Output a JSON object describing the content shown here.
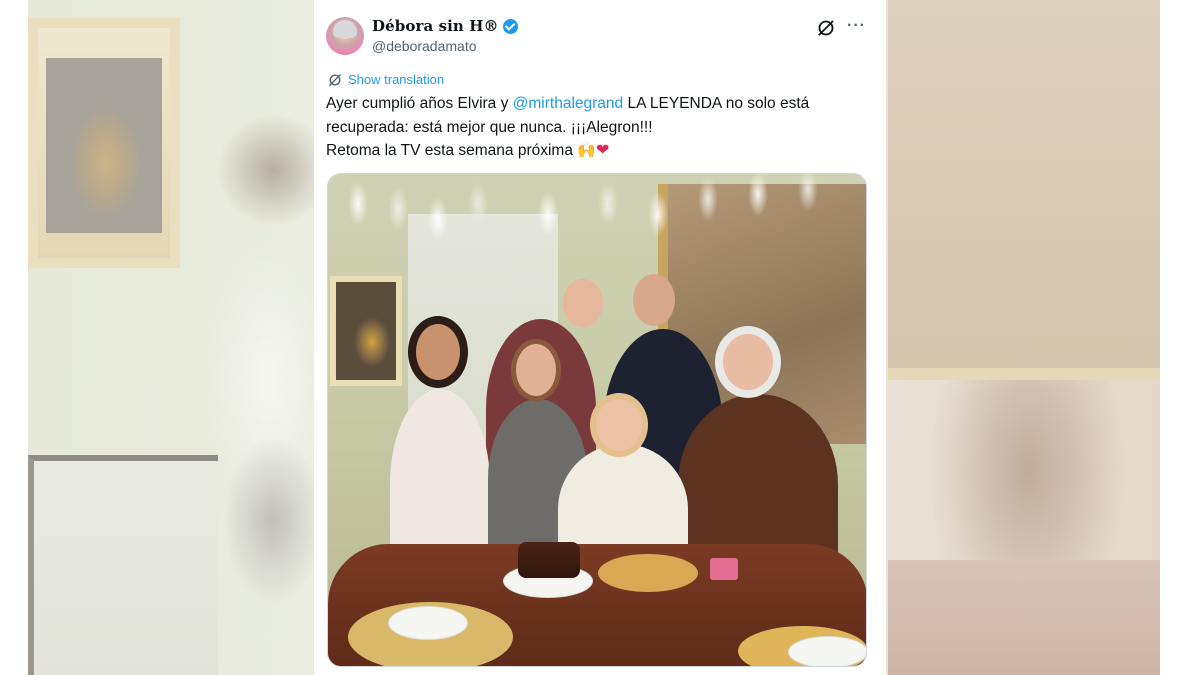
{
  "tweet": {
    "display_name": "Débora sin H®",
    "handle": "@deboradamato",
    "show_translation": "Show translation",
    "text_part1": "Ayer cumplió años Elvira y ",
    "mention": "@mirthalegrand",
    "text_part2": " LA LEYENDA no solo está recuperada: está mejor que nunca. ¡¡¡Alegron!!!",
    "text_line3": "Retoma la TV esta semana próxima ",
    "emoji_hands": "🙌",
    "emoji_heart": "❤",
    "more_label": "···"
  },
  "icons": {
    "verified": "verified-badge-icon",
    "grok": "grok-icon",
    "more": "more-options-icon",
    "translate": "translate-icon"
  },
  "colors": {
    "accent": "#1d9bf0",
    "text": "#0f1419",
    "secondary_text": "#536471"
  }
}
